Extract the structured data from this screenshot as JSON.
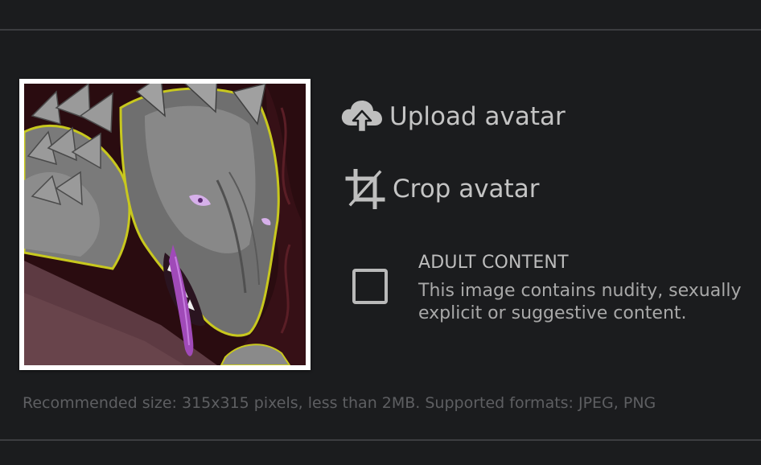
{
  "avatar": {
    "alt": "Avatar image: grey dragon head"
  },
  "actions": {
    "upload": {
      "label": "Upload avatar",
      "icon": "cloud-upload-icon"
    },
    "crop": {
      "label": "Crop avatar",
      "icon": "crop-icon"
    }
  },
  "adult_content": {
    "checked": false,
    "title": "ADULT CONTENT",
    "description": "This image contains nudity, sexually explicit or suggestive content."
  },
  "hint": "Recommended size: 315x315 pixels, less than 2MB. Supported formats: JPEG, PNG",
  "colors": {
    "background": "#1b1c1e",
    "divider": "#3c3d40",
    "text": "#c4c4c4",
    "muted": "#5e5f62"
  }
}
